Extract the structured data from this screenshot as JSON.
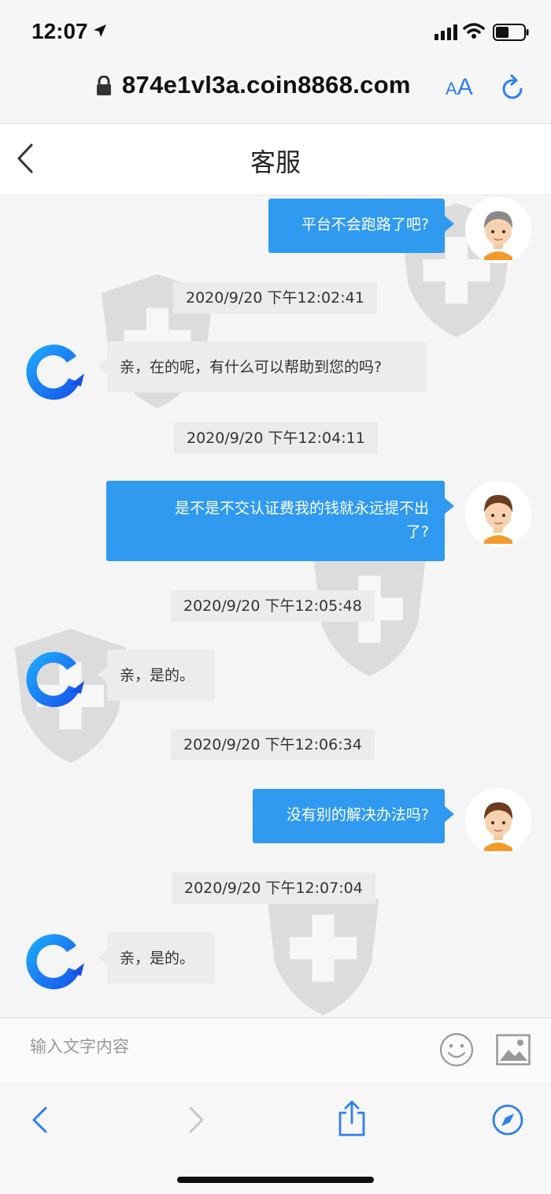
{
  "status_bar": {
    "time": "12:07"
  },
  "url_bar": {
    "url": "874e1vl3a.coin8868.com",
    "text_size_small": "A",
    "text_size_large": "A"
  },
  "header": {
    "title": "客服"
  },
  "messages": [
    {
      "type": "out",
      "text": "平台不会跑路了吧?"
    },
    {
      "type": "timestamp",
      "text": "2020/9/20 下午12:02:41"
    },
    {
      "type": "in",
      "text": "亲，在的呢，有什么可以帮助到您的吗?"
    },
    {
      "type": "timestamp",
      "text": "2020/9/20 下午12:04:11"
    },
    {
      "type": "out",
      "line1": "是不是不交认证费我的钱就永远提不出",
      "line2": "了?"
    },
    {
      "type": "timestamp",
      "text": "2020/9/20 下午12:05:48"
    },
    {
      "type": "in",
      "text": "亲，是的。"
    },
    {
      "type": "timestamp",
      "text": "2020/9/20 下午12:06:34"
    },
    {
      "type": "out",
      "text": "没有别的解决办法吗?"
    },
    {
      "type": "timestamp",
      "text": "2020/9/20 下午12:07:04"
    },
    {
      "type": "in",
      "text": "亲，是的。"
    }
  ],
  "input_bar": {
    "placeholder": "输入文字内容"
  },
  "icons": {
    "status": [
      "location-arrow-icon",
      "signal-icon",
      "wifi-icon",
      "battery-icon"
    ],
    "url": [
      "lock-icon",
      "reload-icon"
    ],
    "header": [
      "back-chevron-icon"
    ],
    "input": [
      "emoji-icon",
      "image-icon"
    ],
    "toolbar": [
      "back-arrow-icon",
      "forward-arrow-icon",
      "share-icon",
      "compass-icon"
    ]
  },
  "colors": {
    "accent": "#2f9af0",
    "ios_blue": "#2d7ff0",
    "bubble_in": "#ececec"
  }
}
